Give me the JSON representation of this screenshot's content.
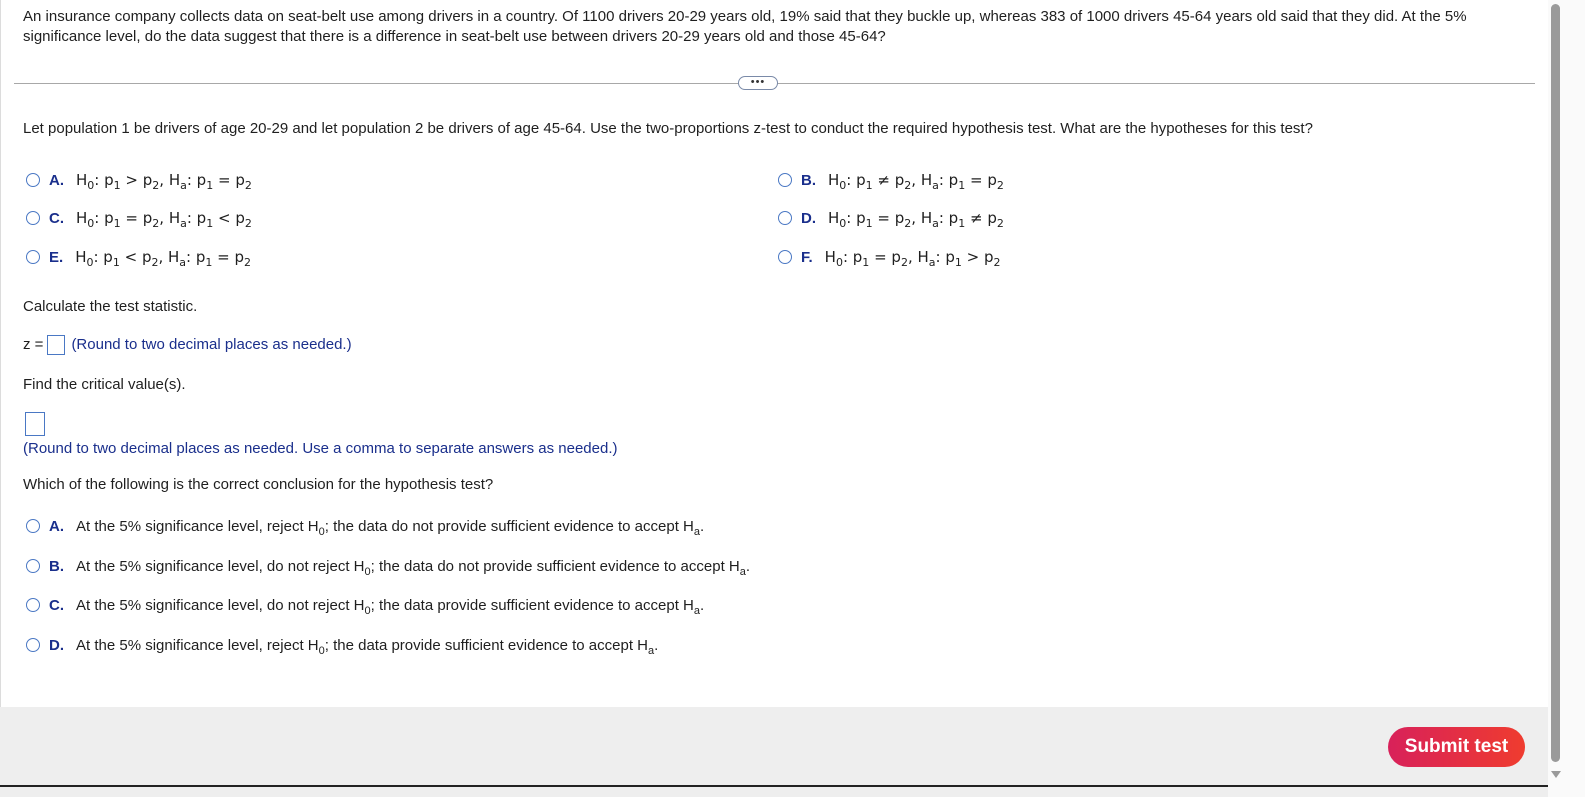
{
  "problem": {
    "text": "An insurance company collects data on seat-belt use among drivers in a country. Of 1100 drivers 20-29 years old, 19% said that they buckle up, whereas 383 of 1000 drivers 45-64 years old said that they did. At the 5% significance level, do the data suggest that there is a difference in seat-belt use between drivers 20-29 years old and those 45-64?"
  },
  "expander_label": "•••",
  "part1": {
    "question": "Let population 1 be drivers of age 20-29 and let population 2 be drivers of age 45-64. Use the two-proportions z-test to conduct the required hypothesis test. What are the hypotheses for this test?",
    "options": [
      {
        "letter": "A.",
        "h0_op": ">",
        "ha_op": "="
      },
      {
        "letter": "B.",
        "h0_op": "≠",
        "ha_op": "="
      },
      {
        "letter": "C.",
        "h0_op": "=",
        "ha_op": "<"
      },
      {
        "letter": "D.",
        "h0_op": "=",
        "ha_op": "≠"
      },
      {
        "letter": "E.",
        "h0_op": "<",
        "ha_op": "="
      },
      {
        "letter": "F.",
        "h0_op": "=",
        "ha_op": ">"
      }
    ]
  },
  "part2": {
    "question": "Calculate the test statistic.",
    "z_label": "z =",
    "hint": "(Round to two decimal places as needed.)"
  },
  "part3": {
    "question": "Find the critical value(s).",
    "hint": "(Round to two decimal places as needed. Use a comma to separate answers as needed.)"
  },
  "part4": {
    "question": "Which of the following is the correct conclusion for the hypothesis test?",
    "options": [
      {
        "letter": "A.",
        "pre": "At the 5% significance level, reject H",
        "mid": "; the data do not provide sufficient evidence to accept H"
      },
      {
        "letter": "B.",
        "pre": "At the 5% significance level, do not reject H",
        "mid": "; the data do not provide sufficient evidence to accept H"
      },
      {
        "letter": "C.",
        "pre": "At the 5% significance level, do not reject H",
        "mid": "; the data provide sufficient evidence to accept H"
      },
      {
        "letter": "D.",
        "pre": "At the 5% significance level, reject H",
        "mid": "; the data provide sufficient evidence to accept H"
      }
    ]
  },
  "submit_label": "Submit test",
  "colors": {
    "accent": "#1a2f8c",
    "radio": "#4a78c4",
    "submit_start": "#d8215a",
    "submit_end": "#ef3c2f"
  }
}
